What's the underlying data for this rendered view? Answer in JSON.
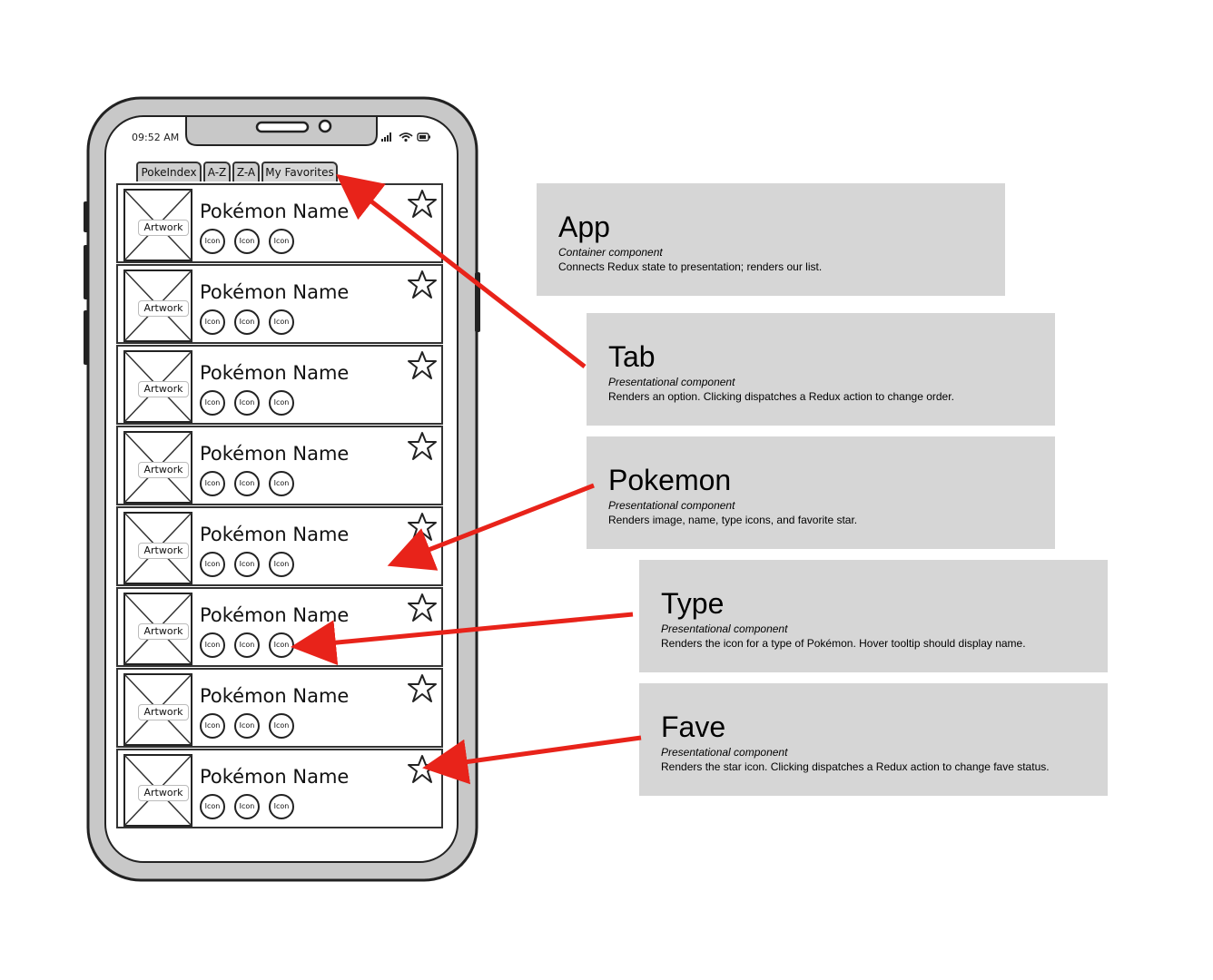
{
  "phone": {
    "time": "09:52 AM",
    "tabs": [
      "PokeIndex",
      "A-Z",
      "Z-A",
      "My Favorites"
    ],
    "cards": [
      {
        "artwork": "Artwork",
        "name": "Pokémon Name",
        "icons": [
          "Icon",
          "Icon",
          "Icon"
        ]
      },
      {
        "artwork": "Artwork",
        "name": "Pokémon Name",
        "icons": [
          "Icon",
          "Icon",
          "Icon"
        ]
      },
      {
        "artwork": "Artwork",
        "name": "Pokémon Name",
        "icons": [
          "Icon",
          "Icon",
          "Icon"
        ]
      },
      {
        "artwork": "Artwork",
        "name": "Pokémon Name",
        "icons": [
          "Icon",
          "Icon",
          "Icon"
        ]
      },
      {
        "artwork": "Artwork",
        "name": "Pokémon Name",
        "icons": [
          "Icon",
          "Icon",
          "Icon"
        ]
      },
      {
        "artwork": "Artwork",
        "name": "Pokémon Name",
        "icons": [
          "Icon",
          "Icon",
          "Icon"
        ]
      },
      {
        "artwork": "Artwork",
        "name": "Pokémon Name",
        "icons": [
          "Icon",
          "Icon",
          "Icon"
        ]
      },
      {
        "artwork": "Artwork",
        "name": "Pokémon Name",
        "icons": [
          "Icon",
          "Icon",
          "Icon"
        ]
      }
    ]
  },
  "components": {
    "app": {
      "title": "App",
      "subtitle": "Container component",
      "desc": "Connects Redux state to presentation; renders our list."
    },
    "tab": {
      "title": "Tab",
      "subtitle": "Presentational component",
      "desc": "Renders an option. Clicking dispatches a Redux action to change order."
    },
    "pokemon": {
      "title": "Pokemon",
      "subtitle": "Presentational component",
      "desc": "Renders image, name, type icons, and favorite star."
    },
    "type": {
      "title": "Type",
      "subtitle": "Presentational component",
      "desc": "Renders the icon for a type of Pokémon. Hover tooltip should display name."
    },
    "fave": {
      "title": "Fave",
      "subtitle": "Presentational component",
      "desc": "Renders the star icon. Clicking dispatches a Redux action to change fave status."
    }
  },
  "colors": {
    "arrow": "#e8231a",
    "box": "#d6d6d6",
    "phone_frame": "#c8c8c8"
  }
}
